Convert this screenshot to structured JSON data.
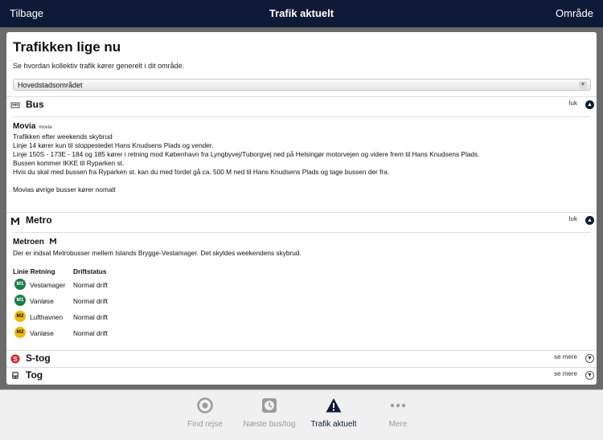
{
  "nav": {
    "back": "Tilbage",
    "title": "Trafik aktuelt",
    "area": "Område"
  },
  "page": {
    "title": "Trafikken lige nu",
    "intro": "Se hvordan kollektiv trafik kører generelt i dit område.",
    "region": "Hovedstadsområdet"
  },
  "sections": {
    "bus": {
      "label": "Bus",
      "toggle": "luk",
      "operator": "Movia",
      "operator_logo": "movia",
      "lines": [
        "Trafikken efter weekends skybrud",
        "Linje 14 kører kun til stoppestedet Hans Knudsens Plads og vender.",
        "Linje 150S - 173E - 184 og 185 kører i retning mod København fra Lyngbyvej/Tuborgvej ned på Helsingør motorvejen og videre frem til Hans Knudsens Plads.",
        "Bussen kommer IKKE til Ryparken st.",
        "Hvis du skal med bussen fra Ryparken st. kan du med fordel gå ca. 500 M ned til Hans Knudsens Plads og tage bussen der fra.",
        "",
        "Movias øvrige busser kører nomalt"
      ]
    },
    "metro": {
      "label": "Metro",
      "toggle": "luk",
      "operator": "Metroen",
      "message": "Der er indsat Metrobusser mellem Islands Brygge-Vestamager. Det skyldes weekendens skybrud.",
      "headers": {
        "line_dir": "Linie Retning",
        "status": "Driftstatus"
      },
      "rows": [
        {
          "line": "M1",
          "direction": "Vestamager",
          "status": "Normal drift"
        },
        {
          "line": "M1",
          "direction": "Vanløse",
          "status": "Normal drift"
        },
        {
          "line": "M2",
          "direction": "Lufthavnen",
          "status": "Normal drift"
        },
        {
          "line": "M2",
          "direction": "Vanløse",
          "status": "Normal drift"
        }
      ]
    },
    "stog": {
      "label": "S-tog",
      "toggle": "se mere"
    },
    "tog": {
      "label": "Tog",
      "toggle": "se mere"
    }
  },
  "tabs": [
    {
      "label": "Find rejse",
      "icon": "target-icon"
    },
    {
      "label": "Næste bus/tog",
      "icon": "clock-icon"
    },
    {
      "label": "Trafik aktuelt",
      "icon": "warning-icon",
      "active": true
    },
    {
      "label": "Mere",
      "icon": "more-dots-icon"
    }
  ],
  "colors": {
    "navbar": "#101a38",
    "m1": "#1a7b4a",
    "m2": "#f2b90c",
    "stog": "#d3212a"
  }
}
